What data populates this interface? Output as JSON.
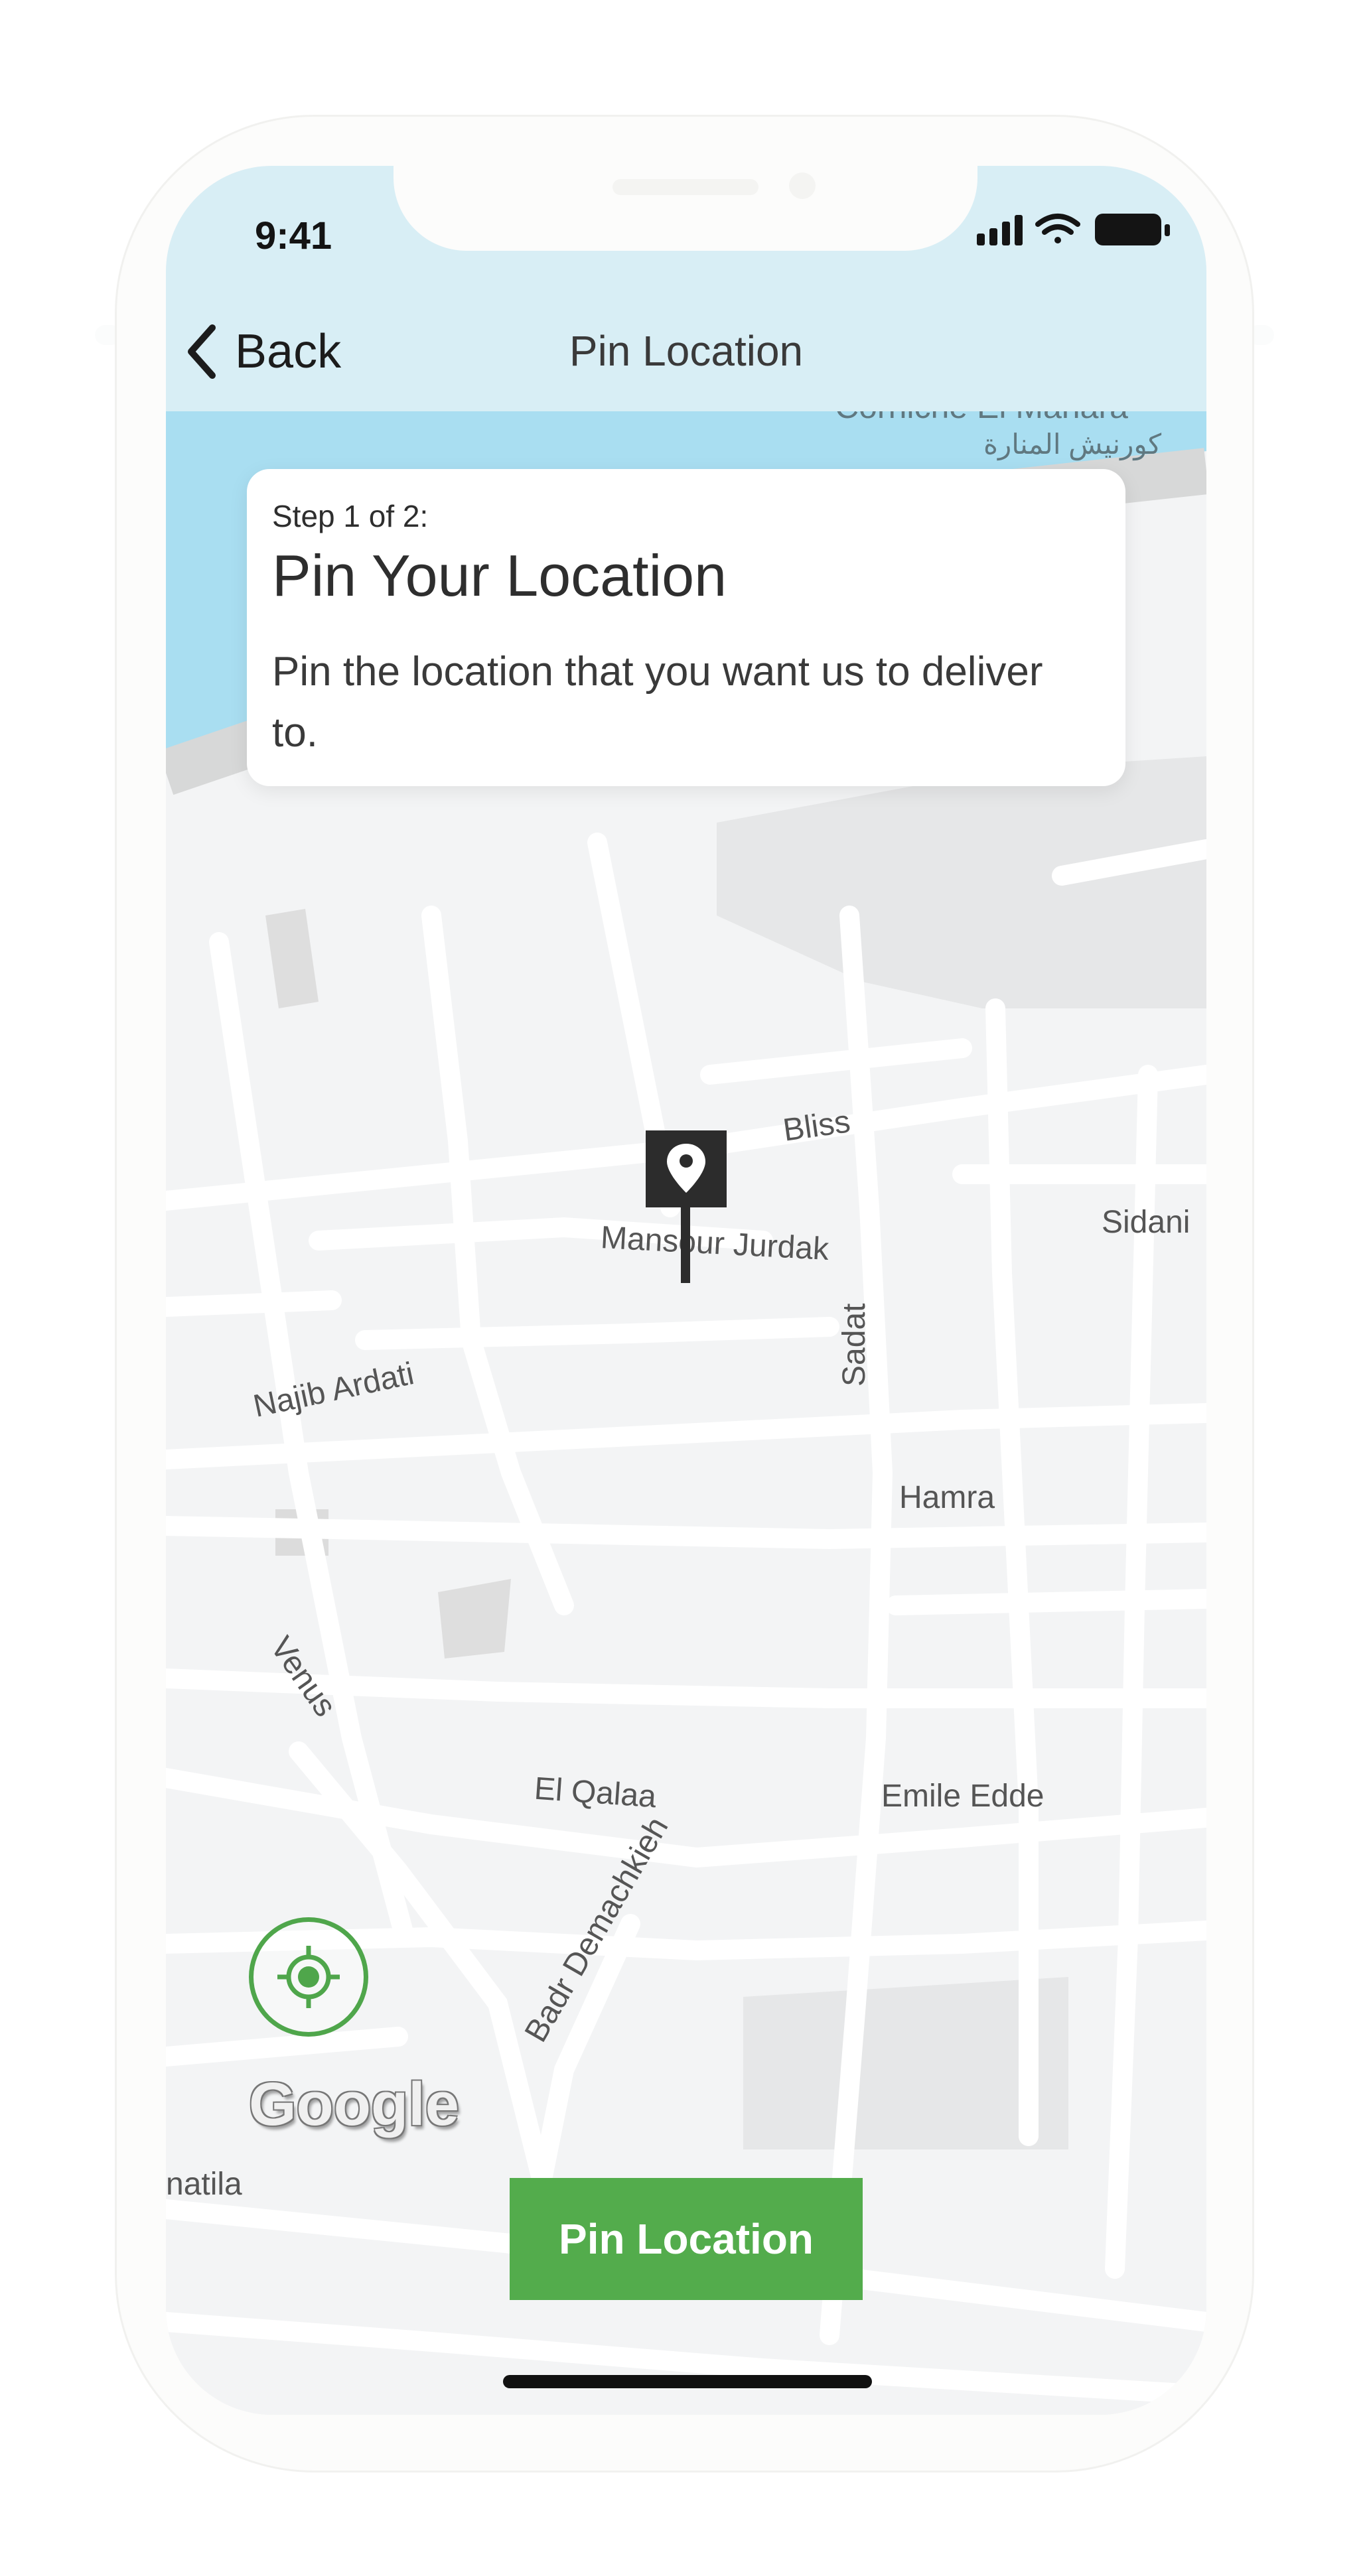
{
  "status_bar": {
    "time": "9:41"
  },
  "nav": {
    "back_label": "Back",
    "title": "Pin Location"
  },
  "info_card": {
    "step": "Step 1 of 2:",
    "title": "Pin Your Location",
    "body": "Pin the location that  you want us to deliver to."
  },
  "map": {
    "labels": {
      "corniche_en": "Corniche El Manara",
      "corniche_ar": "كورنيش المنارة",
      "bliss": "Bliss",
      "mansour_jurdak": "Mansour Jurdak",
      "sidani": "Sidani",
      "najib_ardati": "Najib Ardati",
      "sadat": "Sadat",
      "hamra": "Hamra",
      "venus": "Venus",
      "el_qalaa": "El Qalaa",
      "emile_edde": "Emile Edde",
      "badr_demachkieh": "Badr Demachkieh",
      "natila": "natila"
    },
    "attribution": "Google"
  },
  "actions": {
    "pin_location_label": "Pin Location"
  },
  "colors": {
    "accent": "#53ac4c",
    "header_bg": "#d8eef5",
    "water": "#a9def1",
    "map_land": "#f3f4f5"
  }
}
